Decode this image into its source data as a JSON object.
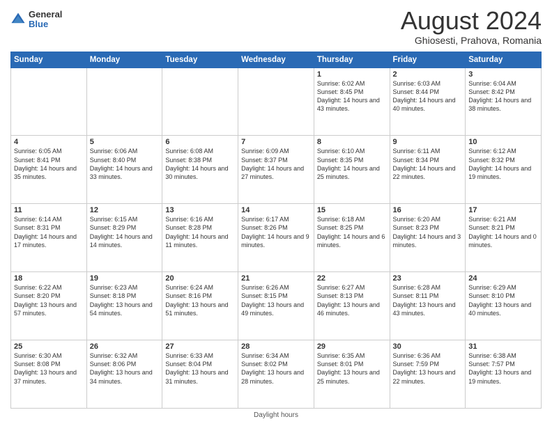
{
  "header": {
    "logo_general": "General",
    "logo_blue": "Blue",
    "month_year": "August 2024",
    "location": "Ghiosesti, Prahova, Romania"
  },
  "days_of_week": [
    "Sunday",
    "Monday",
    "Tuesday",
    "Wednesday",
    "Thursday",
    "Friday",
    "Saturday"
  ],
  "weeks": [
    [
      {
        "day": "",
        "info": ""
      },
      {
        "day": "",
        "info": ""
      },
      {
        "day": "",
        "info": ""
      },
      {
        "day": "",
        "info": ""
      },
      {
        "day": "1",
        "info": "Sunrise: 6:02 AM\nSunset: 8:45 PM\nDaylight: 14 hours and 43 minutes."
      },
      {
        "day": "2",
        "info": "Sunrise: 6:03 AM\nSunset: 8:44 PM\nDaylight: 14 hours and 40 minutes."
      },
      {
        "day": "3",
        "info": "Sunrise: 6:04 AM\nSunset: 8:42 PM\nDaylight: 14 hours and 38 minutes."
      }
    ],
    [
      {
        "day": "4",
        "info": "Sunrise: 6:05 AM\nSunset: 8:41 PM\nDaylight: 14 hours and 35 minutes."
      },
      {
        "day": "5",
        "info": "Sunrise: 6:06 AM\nSunset: 8:40 PM\nDaylight: 14 hours and 33 minutes."
      },
      {
        "day": "6",
        "info": "Sunrise: 6:08 AM\nSunset: 8:38 PM\nDaylight: 14 hours and 30 minutes."
      },
      {
        "day": "7",
        "info": "Sunrise: 6:09 AM\nSunset: 8:37 PM\nDaylight: 14 hours and 27 minutes."
      },
      {
        "day": "8",
        "info": "Sunrise: 6:10 AM\nSunset: 8:35 PM\nDaylight: 14 hours and 25 minutes."
      },
      {
        "day": "9",
        "info": "Sunrise: 6:11 AM\nSunset: 8:34 PM\nDaylight: 14 hours and 22 minutes."
      },
      {
        "day": "10",
        "info": "Sunrise: 6:12 AM\nSunset: 8:32 PM\nDaylight: 14 hours and 19 minutes."
      }
    ],
    [
      {
        "day": "11",
        "info": "Sunrise: 6:14 AM\nSunset: 8:31 PM\nDaylight: 14 hours and 17 minutes."
      },
      {
        "day": "12",
        "info": "Sunrise: 6:15 AM\nSunset: 8:29 PM\nDaylight: 14 hours and 14 minutes."
      },
      {
        "day": "13",
        "info": "Sunrise: 6:16 AM\nSunset: 8:28 PM\nDaylight: 14 hours and 11 minutes."
      },
      {
        "day": "14",
        "info": "Sunrise: 6:17 AM\nSunset: 8:26 PM\nDaylight: 14 hours and 9 minutes."
      },
      {
        "day": "15",
        "info": "Sunrise: 6:18 AM\nSunset: 8:25 PM\nDaylight: 14 hours and 6 minutes."
      },
      {
        "day": "16",
        "info": "Sunrise: 6:20 AM\nSunset: 8:23 PM\nDaylight: 14 hours and 3 minutes."
      },
      {
        "day": "17",
        "info": "Sunrise: 6:21 AM\nSunset: 8:21 PM\nDaylight: 14 hours and 0 minutes."
      }
    ],
    [
      {
        "day": "18",
        "info": "Sunrise: 6:22 AM\nSunset: 8:20 PM\nDaylight: 13 hours and 57 minutes."
      },
      {
        "day": "19",
        "info": "Sunrise: 6:23 AM\nSunset: 8:18 PM\nDaylight: 13 hours and 54 minutes."
      },
      {
        "day": "20",
        "info": "Sunrise: 6:24 AM\nSunset: 8:16 PM\nDaylight: 13 hours and 51 minutes."
      },
      {
        "day": "21",
        "info": "Sunrise: 6:26 AM\nSunset: 8:15 PM\nDaylight: 13 hours and 49 minutes."
      },
      {
        "day": "22",
        "info": "Sunrise: 6:27 AM\nSunset: 8:13 PM\nDaylight: 13 hours and 46 minutes."
      },
      {
        "day": "23",
        "info": "Sunrise: 6:28 AM\nSunset: 8:11 PM\nDaylight: 13 hours and 43 minutes."
      },
      {
        "day": "24",
        "info": "Sunrise: 6:29 AM\nSunset: 8:10 PM\nDaylight: 13 hours and 40 minutes."
      }
    ],
    [
      {
        "day": "25",
        "info": "Sunrise: 6:30 AM\nSunset: 8:08 PM\nDaylight: 13 hours and 37 minutes."
      },
      {
        "day": "26",
        "info": "Sunrise: 6:32 AM\nSunset: 8:06 PM\nDaylight: 13 hours and 34 minutes."
      },
      {
        "day": "27",
        "info": "Sunrise: 6:33 AM\nSunset: 8:04 PM\nDaylight: 13 hours and 31 minutes."
      },
      {
        "day": "28",
        "info": "Sunrise: 6:34 AM\nSunset: 8:02 PM\nDaylight: 13 hours and 28 minutes."
      },
      {
        "day": "29",
        "info": "Sunrise: 6:35 AM\nSunset: 8:01 PM\nDaylight: 13 hours and 25 minutes."
      },
      {
        "day": "30",
        "info": "Sunrise: 6:36 AM\nSunset: 7:59 PM\nDaylight: 13 hours and 22 minutes."
      },
      {
        "day": "31",
        "info": "Sunrise: 6:38 AM\nSunset: 7:57 PM\nDaylight: 13 hours and 19 minutes."
      }
    ]
  ],
  "footer": {
    "daylight_label": "Daylight hours"
  }
}
